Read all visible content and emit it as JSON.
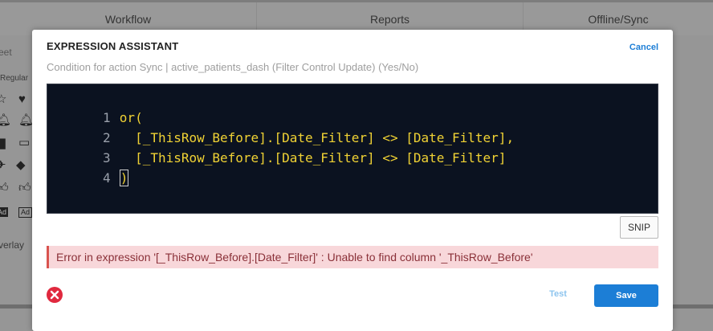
{
  "background": {
    "tabs": [
      "Workflow",
      "Reports",
      "Offline/Sync"
    ],
    "sidebar": {
      "text_top": "eet",
      "text_style": "Regular",
      "text_bottom": "verlay"
    }
  },
  "modal": {
    "title": "EXPRESSION ASSISTANT",
    "cancel_label": "Cancel",
    "subtitle": "Condition for action Sync | active_patients_dash (Filter Control Update) (Yes/No)",
    "editor": {
      "lines": [
        {
          "num": "1",
          "text": "or("
        },
        {
          "num": "2",
          "text": "  [_ThisRow_Before].[Date_Filter] <> [Date_Filter],"
        },
        {
          "num": "3",
          "text": "  [_ThisRow_Before].[Date_Filter] <> [Date_Filter]"
        },
        {
          "num": "4",
          "text": ")"
        }
      ]
    },
    "snip_label": "SNIP",
    "error_message": "Error in expression '[_ThisRow_Before].[Date_Filter]' : Unable to find column '_ThisRow_Before'",
    "test_label": "Test",
    "save_label": "Save"
  },
  "colors": {
    "accent": "#1c7ed6",
    "error_bg": "#f8d7da",
    "error_icon": "#e0293e",
    "code_text": "#f0d234",
    "editor_bg": "#0b1220"
  }
}
